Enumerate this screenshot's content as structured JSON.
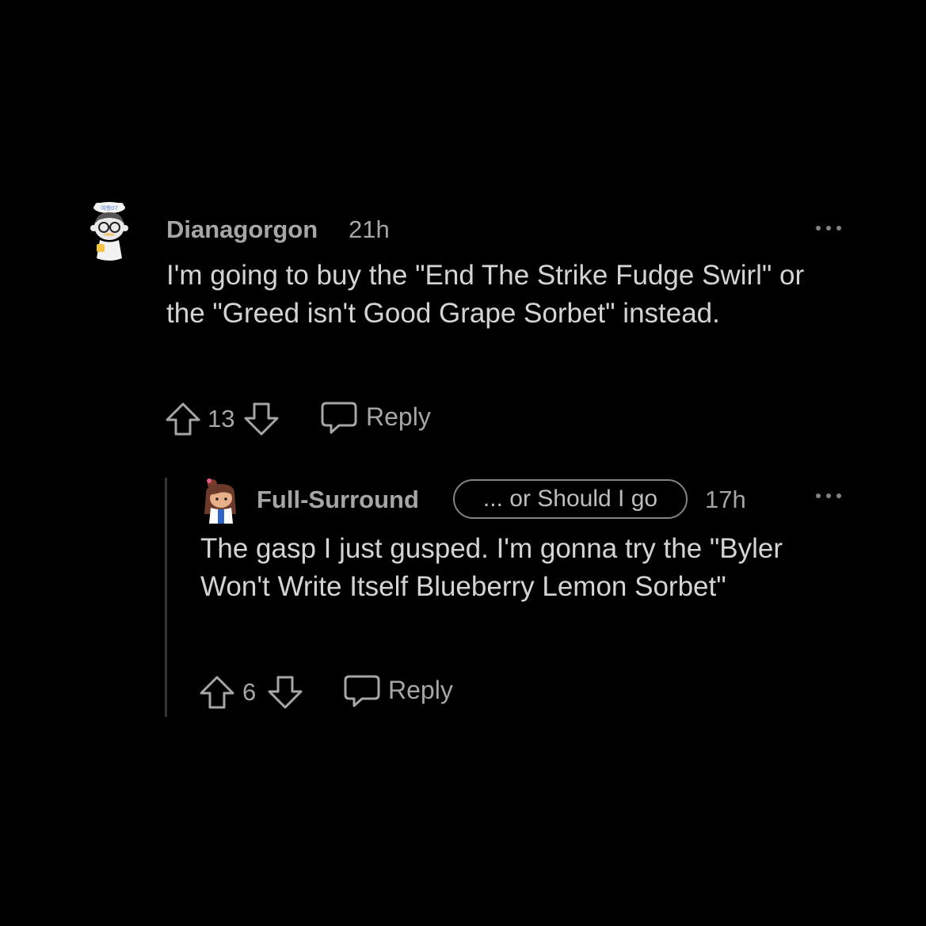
{
  "comments": [
    {
      "username": "Dianagorgon",
      "timestamp": "21h",
      "body": "I'm going to buy the \"End The Strike Fudge Swirl\" or the \"Greed isn't Good Grape Sorbet\" instead.",
      "score": "13",
      "reply_label": "Reply",
      "avatar_icon": "snoo-sailor-avatar-icon"
    },
    {
      "username": "Full-Surround",
      "flair": "... or Should I go",
      "timestamp": "17h",
      "body": "The gasp I just gusped. I'm gonna try the \"Byler Won't Write Itself Blueberry Lemon Sorbet\"",
      "score": "6",
      "reply_label": "Reply",
      "avatar_icon": "snoo-girl-avatar-icon"
    }
  ],
  "icons": {
    "upvote": "arrow-up-outline-icon",
    "downvote": "arrow-down-outline-icon",
    "reply": "speech-bubble-icon",
    "more": "ellipsis-icon"
  },
  "colors": {
    "background": "#000000",
    "text_primary": "#d4d4d4",
    "text_secondary": "#a6a6a6",
    "thread_line": "#343536"
  }
}
